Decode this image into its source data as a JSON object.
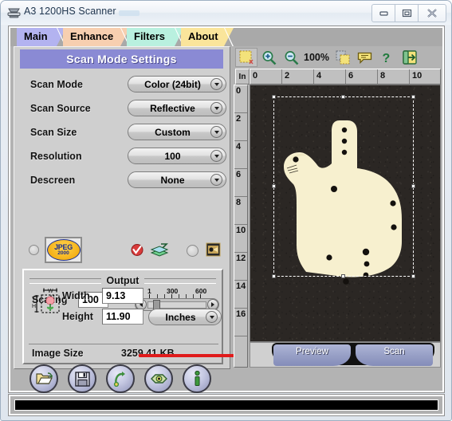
{
  "window": {
    "title": "A3 1200HS Scanner",
    "icon": "scanner-icon",
    "minimize_label": "Minimize",
    "maximize_label": "Maximize",
    "close_label": "Close"
  },
  "tabs": [
    {
      "label": "Main",
      "color": "#b3b3f0",
      "active": true
    },
    {
      "label": "Enhance",
      "color": "#f7cfb0",
      "active": false
    },
    {
      "label": "Filters",
      "color": "#b9f0df",
      "active": false
    },
    {
      "label": "About",
      "color": "#fae59b",
      "active": false
    }
  ],
  "settings": {
    "banner_title": "Scan Mode Settings",
    "banner_color": "#8a8ad4",
    "rows": [
      {
        "label": "Scan Mode",
        "value": "Color (24bit)",
        "name": "scan-mode"
      },
      {
        "label": "Scan Source",
        "value": "Reflective",
        "name": "scan-source"
      },
      {
        "label": "Scan Size",
        "value": "Custom",
        "name": "scan-size"
      },
      {
        "label": "Resolution",
        "value": "100",
        "name": "resolution"
      },
      {
        "label": "Descreen",
        "value": "None",
        "name": "descreen"
      }
    ],
    "format_row": {
      "jpeg2000_label_top": "JPEG",
      "jpeg2000_label_bottom": "2000",
      "radio_left_selected": false,
      "radio_right_selected": false,
      "check_icon": "red-check-icon",
      "layers_icon": "layers-icon",
      "film_icon": "film-strip-icon"
    }
  },
  "output": {
    "title": "Output",
    "scaling_label": "Scaling",
    "scaling_value": "100",
    "percent_symbol": "%",
    "slider_ticks": [
      "1",
      "300",
      "600"
    ],
    "width_label": "Width",
    "width_value": "9.13",
    "height_label": "Height",
    "height_value": "11.90",
    "units_value": "Inches",
    "image_size_label": "Image Size",
    "image_size_value": "3259.41 KB",
    "annotation_color": "#e01b1b"
  },
  "action_buttons": [
    {
      "name": "open-folder-button",
      "icon": "open-folder-icon"
    },
    {
      "name": "save-button",
      "icon": "floppy-disk-icon"
    },
    {
      "name": "reset-button",
      "icon": "undo-arrow-icon"
    },
    {
      "name": "calibrate-button",
      "icon": "eye-icon"
    },
    {
      "name": "info-button",
      "icon": "info-icon"
    }
  ],
  "preview": {
    "toolbar": {
      "select_area_icon": "marquee-select-icon",
      "zoom_in_icon": "zoom-in-icon",
      "zoom_out_icon": "zoom-out-icon",
      "zoom_level": "100%",
      "auto_select_icon": "auto-select-icon",
      "tooltip_icon": "speech-bubble-icon",
      "help_icon": "help-question-icon",
      "exit_icon": "exit-door-icon"
    },
    "ruler_unit": "In",
    "h_ticks": [
      "0",
      "2",
      "4",
      "6",
      "8",
      "10"
    ],
    "v_ticks": [
      "0",
      "2",
      "4",
      "6",
      "8",
      "10",
      "12",
      "14",
      "16"
    ],
    "background_color": "#2b2724",
    "object_color": "#f7f0cf"
  },
  "scan_actions": {
    "preview_label": "Preview",
    "scan_label": "Scan"
  },
  "status": {
    "text": ""
  }
}
